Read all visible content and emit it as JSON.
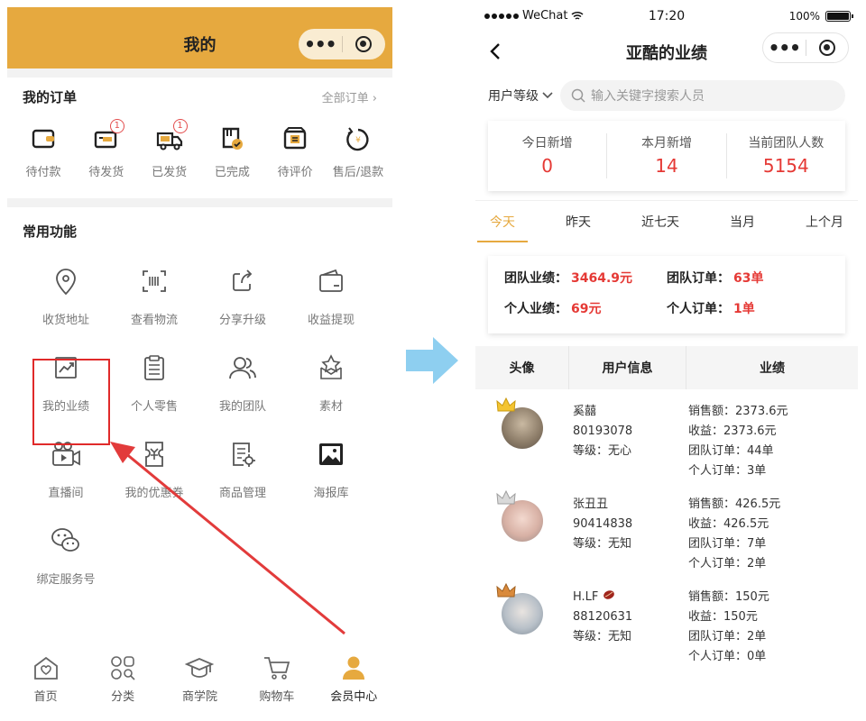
{
  "left": {
    "header": {
      "title": "我的"
    },
    "orders": {
      "title": "我的订单",
      "all_link": "全部订单 ›",
      "items": [
        {
          "label": "待付款",
          "icon": "wallet-icon",
          "badge": ""
        },
        {
          "label": "待发货",
          "icon": "package-icon",
          "badge": "1"
        },
        {
          "label": "已发货",
          "icon": "truck-icon",
          "badge": "1"
        },
        {
          "label": "已完成",
          "icon": "done-box-icon",
          "badge": ""
        },
        {
          "label": "待评价",
          "icon": "review-icon",
          "badge": ""
        },
        {
          "label": "售后/退款",
          "icon": "refund-icon",
          "badge": ""
        }
      ]
    },
    "functions": {
      "title": "常用功能",
      "items": [
        {
          "label": "收货地址",
          "icon": "location-icon"
        },
        {
          "label": "查看物流",
          "icon": "barcode-icon"
        },
        {
          "label": "分享升级",
          "icon": "share-icon"
        },
        {
          "label": "收益提现",
          "icon": "wallet-withdraw-icon"
        },
        {
          "label": "我的业绩",
          "icon": "chart-icon"
        },
        {
          "label": "个人零售",
          "icon": "clipboard-icon"
        },
        {
          "label": "我的团队",
          "icon": "team-icon"
        },
        {
          "label": "素材",
          "icon": "star-box-icon"
        },
        {
          "label": "直播间",
          "icon": "video-camera-icon"
        },
        {
          "label": "我的优惠券",
          "icon": "coupon-icon"
        },
        {
          "label": "商品管理",
          "icon": "product-settings-icon"
        },
        {
          "label": "海报库",
          "icon": "image-icon"
        },
        {
          "label": "绑定服务号",
          "icon": "wechat-icon"
        }
      ]
    },
    "tabbar": [
      {
        "label": "首页",
        "icon": "home-icon"
      },
      {
        "label": "分类",
        "icon": "category-icon"
      },
      {
        "label": "商学院",
        "icon": "academy-icon"
      },
      {
        "label": "购物车",
        "icon": "cart-icon"
      },
      {
        "label": "会员中心",
        "icon": "user-icon"
      }
    ]
  },
  "right": {
    "statusbar": {
      "carrier": "WeChat",
      "time": "17:20",
      "battery": "100%"
    },
    "navbar": {
      "title": "亚酷的业绩"
    },
    "filter": {
      "dropdown": "用户等级",
      "placeholder": "输入关键字搜索人员"
    },
    "stats": [
      {
        "label": "今日新增",
        "value": "0"
      },
      {
        "label": "本月新增",
        "value": "14"
      },
      {
        "label": "当前团队人数",
        "value": "5154"
      }
    ],
    "periods": [
      "今天",
      "昨天",
      "近七天",
      "当月",
      "上个月"
    ],
    "performance": {
      "team_sales_label": "团队业绩：",
      "team_sales": "3464.9元",
      "team_orders_label": "团队订单：",
      "team_orders": "63单",
      "personal_sales_label": "个人业绩：",
      "personal_sales": "69元",
      "personal_orders_label": "个人订单：",
      "personal_orders": "1单"
    },
    "table_headers": [
      "头像",
      "用户信息",
      "业绩"
    ],
    "members": [
      {
        "name": "奚囍",
        "id": "80193078",
        "level": "等级：无心",
        "sales": "销售额：2373.6元",
        "income": "收益：2373.6元",
        "team_orders": "团队订单：44单",
        "personal_orders": "个人订单：3单"
      },
      {
        "name": "张丑丑",
        "id": "90414838",
        "level": "等级：无知",
        "sales": "销售额：426.5元",
        "income": "收益：426.5元",
        "team_orders": "团队订单：7单",
        "personal_orders": "个人订单：2单"
      },
      {
        "name": "H.LF",
        "id": "88120631",
        "level": "等级：无知",
        "sales": "销售额：150元",
        "income": "收益：150元",
        "team_orders": "团队订单：2单",
        "personal_orders": "个人订单：0单"
      }
    ]
  },
  "colors": {
    "accent": "#e6a93f",
    "red": "#e53935",
    "arrow_blue": "#8ecff0"
  }
}
